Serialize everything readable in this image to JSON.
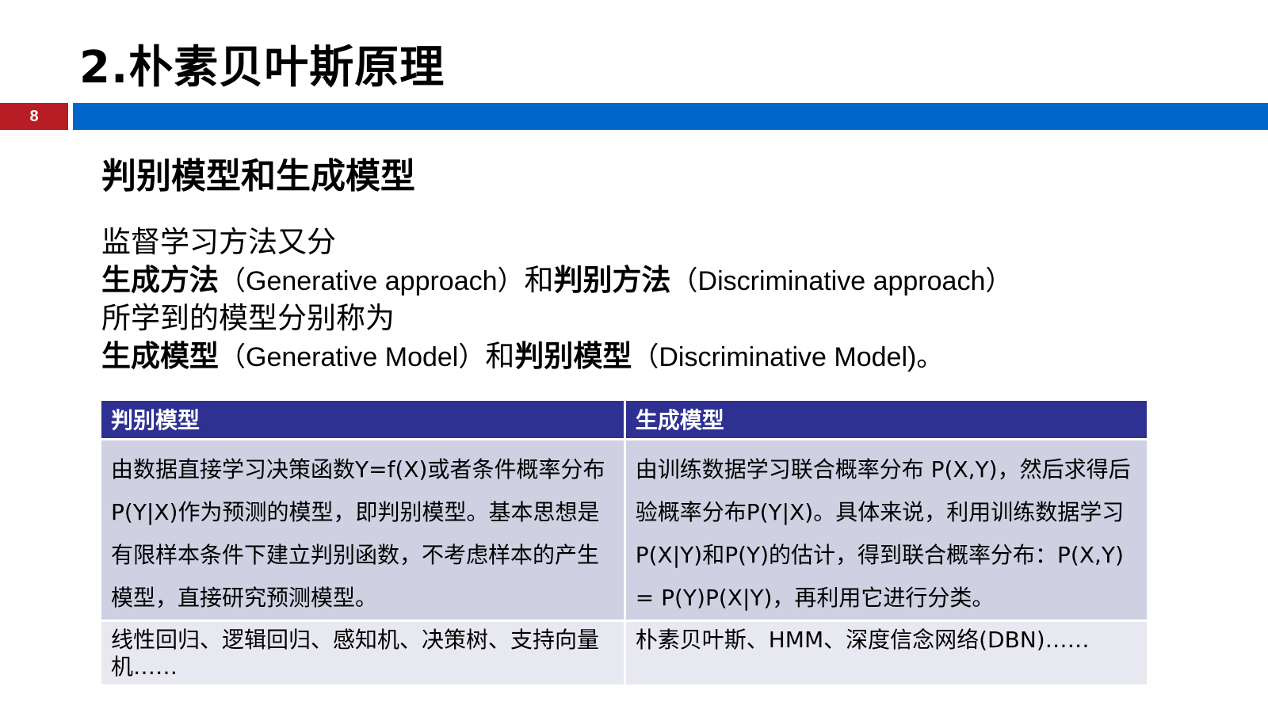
{
  "slide": {
    "title": "2.朴素贝叶斯原理",
    "page_number": "8",
    "subtitle": "判别模型和生成模型"
  },
  "intro": {
    "line1": "监督学习方法又分",
    "gen_method": "生成方法",
    "gen_method_en": "（Generative approach）",
    "and1": "和",
    "disc_method": "判别方法",
    "disc_method_en": "（Discriminative approach）",
    "line3": "所学到的模型分别称为",
    "gen_model": "生成模型",
    "gen_model_en": "（Generative Model）",
    "and2": "和",
    "disc_model": "判别模型",
    "disc_model_en": "（Discriminative Model)。"
  },
  "table": {
    "headers": [
      "判别模型",
      "生成模型"
    ],
    "rows": [
      [
        "由数据直接学习决策函数Y=f(X)或者条件概率分布P(Y|X)作为预测的模型，即判别模型。基本思想是有限样本条件下建立判别函数，不考虑样本的产生模型，直接研究预测模型。",
        "由训练数据学习联合概率分布 P(X,Y)，然后求得后验概率分布P(Y|X)。具体来说，利用训练数据学习P(X|Y)和P(Y)的估计，得到联合概率分布：P(X,Y) = P(Y)P(X|Y)，再利用它进行分类。"
      ],
      [
        "线性回归、逻辑回归、感知机、决策树、支持向量机……",
        "朴素贝叶斯、HMM、深度信念网络(DBN)……"
      ]
    ]
  },
  "colors": {
    "title_bar_blue": "#0066cc",
    "page_badge_red": "#b81c24",
    "table_header": "#2e3192",
    "row1_bg": "#cfd0e2",
    "row2_bg": "#e8e9f0"
  }
}
